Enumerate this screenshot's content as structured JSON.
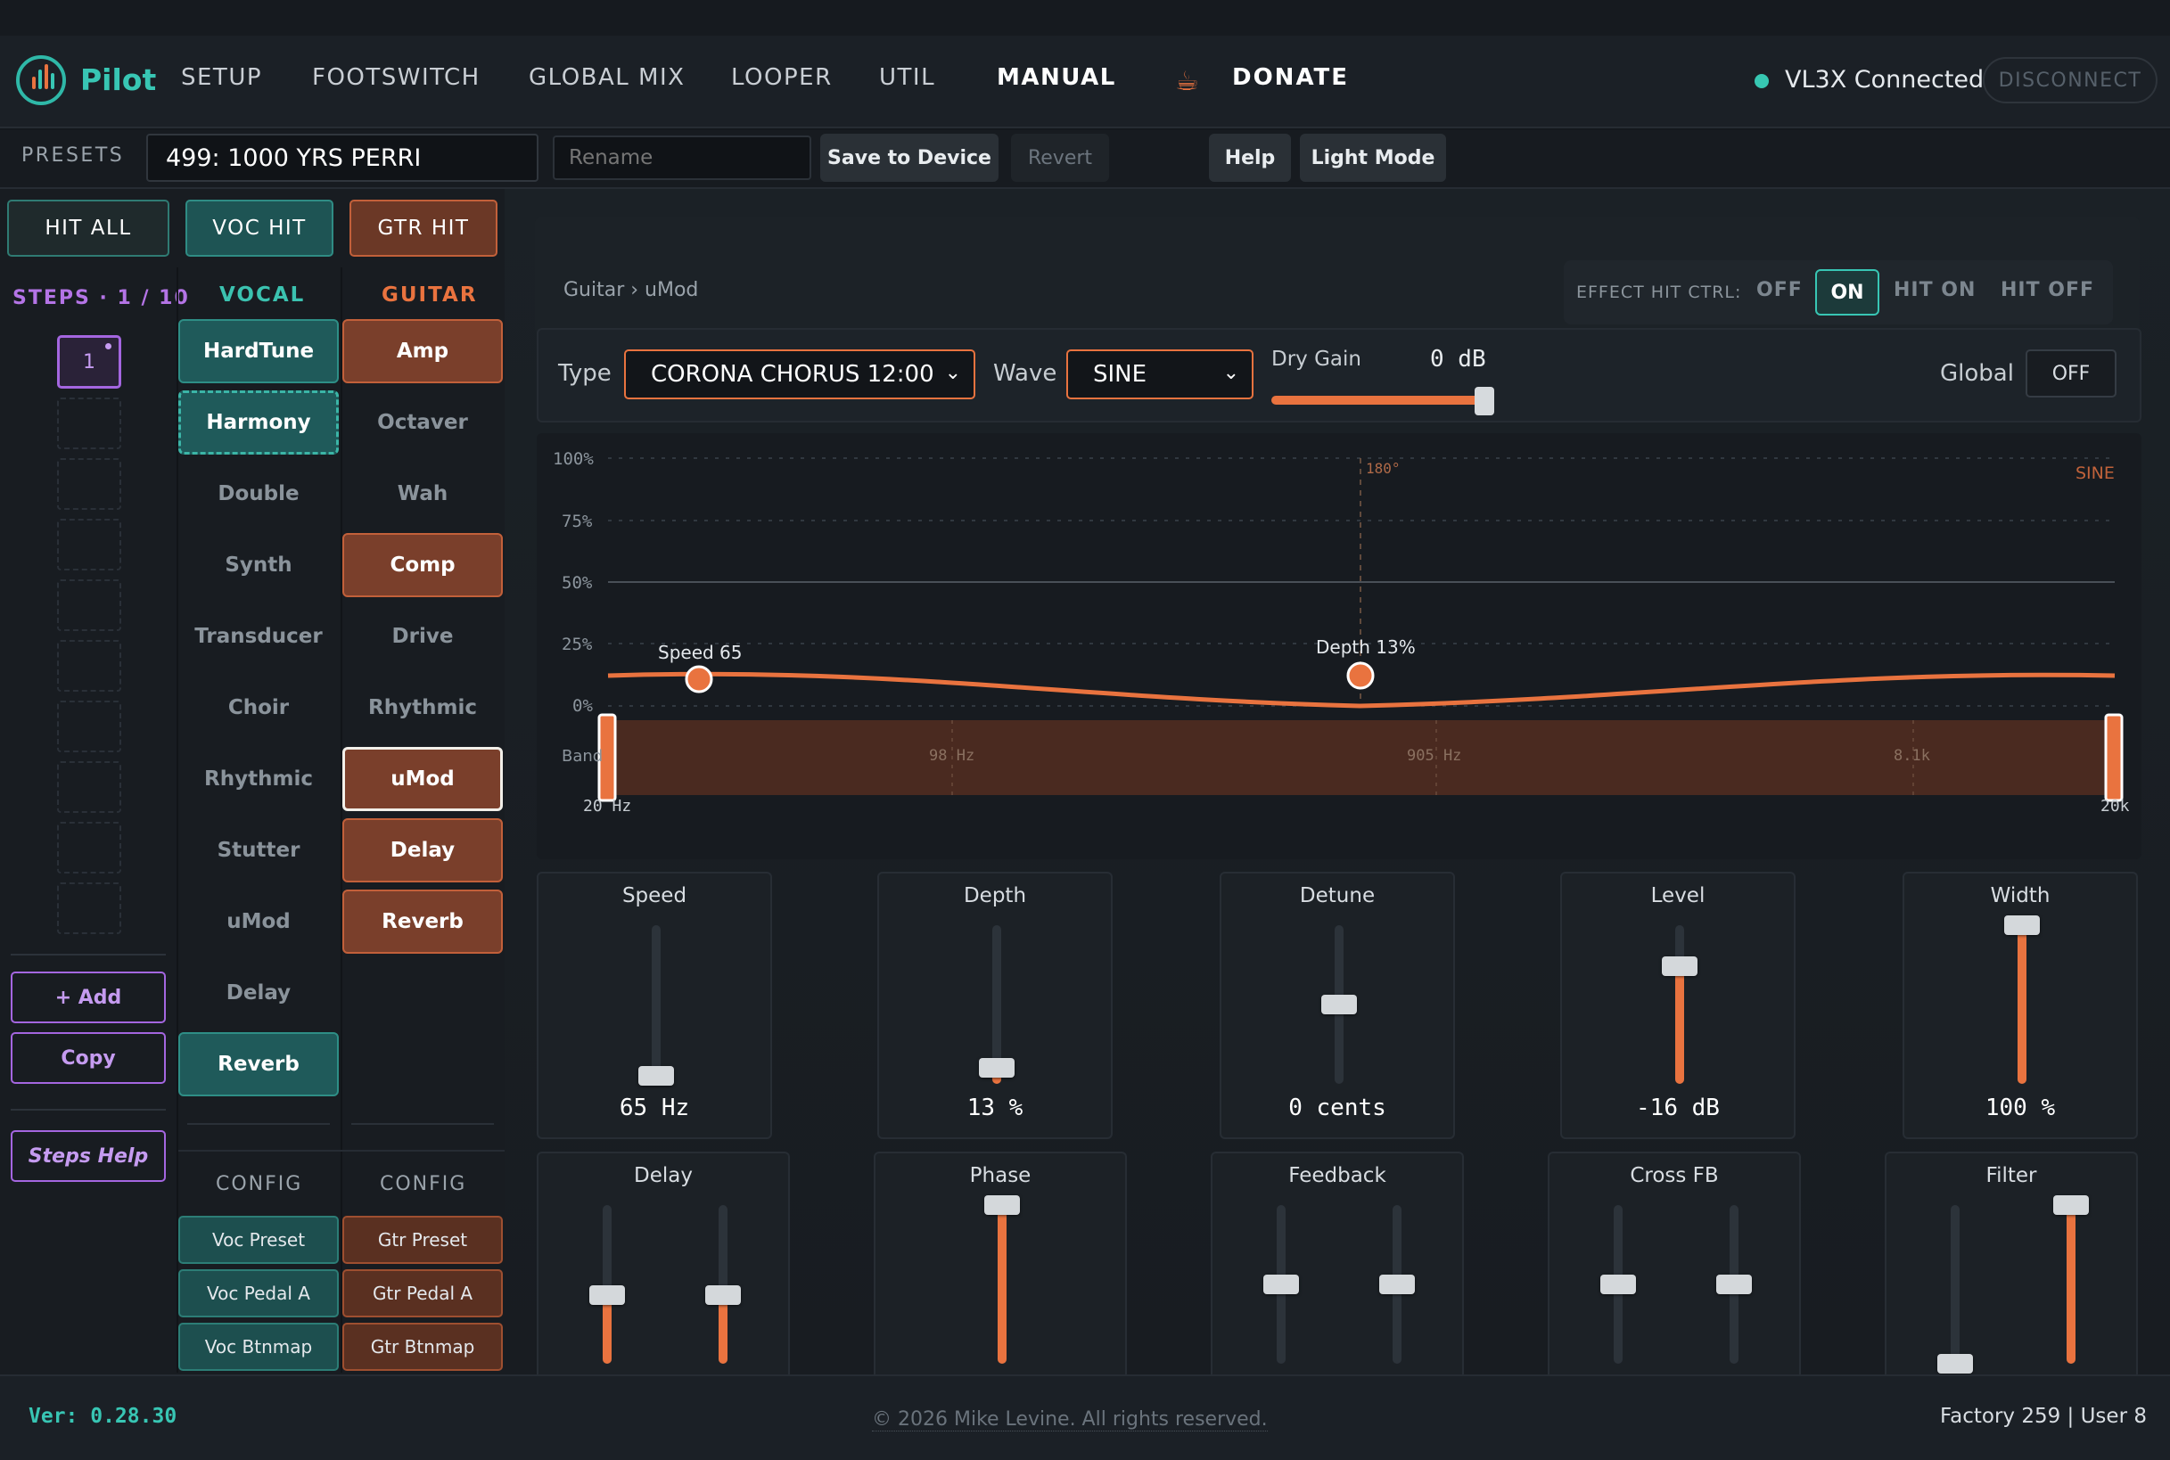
{
  "app": {
    "name": "Pilot",
    "nav": [
      "SETUP",
      "FOOTSWITCH",
      "GLOBAL MIX",
      "LOOPER",
      "UTIL",
      "MANUAL"
    ],
    "active_nav": "MANUAL",
    "donate": "DONATE",
    "connection": "VL3X Connected",
    "disconnect": "DISCONNECT"
  },
  "presets": {
    "label": "PRESETS",
    "current": "499: 1000 YRS PERRI",
    "rename_placeholder": "Rename",
    "save": "Save to Device",
    "revert": "Revert",
    "help": "Help",
    "light_mode": "Light Mode"
  },
  "hits": {
    "all": "HIT ALL",
    "voc": "VOC HIT",
    "gtr": "GTR HIT"
  },
  "steps": {
    "label": "STEPS · 1 / 10",
    "current": "1",
    "add": "+ Add",
    "copy": "Copy",
    "help": "Steps Help"
  },
  "vocal": {
    "header": "VOCAL",
    "effects": [
      "HardTune",
      "Harmony",
      "Double",
      "Synth",
      "Transducer",
      "Choir",
      "Rhythmic",
      "Stutter",
      "uMod",
      "Delay",
      "Reverb"
    ],
    "config_header": "CONFIG",
    "config": [
      "Voc Preset",
      "Voc Pedal A",
      "Voc Btnmap"
    ]
  },
  "guitar": {
    "header": "GUITAR",
    "effects": [
      "Amp",
      "Octaver",
      "Wah",
      "Comp",
      "Drive",
      "Rhythmic",
      "uMod",
      "Delay",
      "Reverb"
    ],
    "config_header": "CONFIG",
    "config": [
      "Gtr Preset",
      "Gtr Pedal A",
      "Gtr Btnmap"
    ]
  },
  "effect": {
    "breadcrumb": "Guitar › uMod",
    "hit_ctrl_label": "EFFECT HIT CTRL:",
    "hit_ctrl_options": [
      "OFF",
      "ON",
      "HIT ON",
      "HIT OFF"
    ],
    "hit_ctrl_selected": "ON",
    "type_label": "Type",
    "type_value": "CORONA CHORUS 12:00",
    "wave_label": "Wave",
    "wave_value": "SINE",
    "dry_gain_label": "Dry Gain",
    "dry_gain_value": "0 dB",
    "global_label": "Global",
    "global_value": "OFF"
  },
  "graph": {
    "y_ticks": [
      "100%",
      "75%",
      "50%",
      "25%",
      "0%"
    ],
    "marker_label": "180°",
    "wave_label": "SINE",
    "speed_label": "Speed 65",
    "depth_label": "Depth 13%",
    "band_label": "Band",
    "freq_ticks": [
      "98 Hz",
      "905 Hz",
      "8.1k"
    ],
    "range_low": "20 Hz",
    "range_high": "20k"
  },
  "sliders_row1": [
    {
      "name": "Speed",
      "value": "65 Hz",
      "level": 0.05
    },
    {
      "name": "Depth",
      "value": "13 %",
      "level": 0.1
    },
    {
      "name": "Detune",
      "value": "0 cents",
      "level": 0.5
    },
    {
      "name": "Level",
      "value": "-16 dB",
      "level": 0.74
    },
    {
      "name": "Width",
      "value": "100 %",
      "level": 1.0
    }
  ],
  "sliders_row2": [
    {
      "name": "Delay",
      "levels": [
        0.43,
        0.43
      ]
    },
    {
      "name": "Phase",
      "levels": [
        1.0
      ]
    },
    {
      "name": "Feedback",
      "levels": [
        0.5,
        0.5
      ]
    },
    {
      "name": "Cross FB",
      "levels": [
        0.5,
        0.5
      ]
    },
    {
      "name": "Filter",
      "levels": [
        0.0,
        1.0
      ]
    }
  ],
  "footer": {
    "version": "Ver: 0.28.30",
    "copyright": "© 2026 Mike Levine. All rights reserved.",
    "counts": "Factory 259 | User 8"
  },
  "colors": {
    "accent_orange": "#e9733f",
    "accent_teal": "#38c6b4",
    "accent_purple": "#a466e0"
  }
}
